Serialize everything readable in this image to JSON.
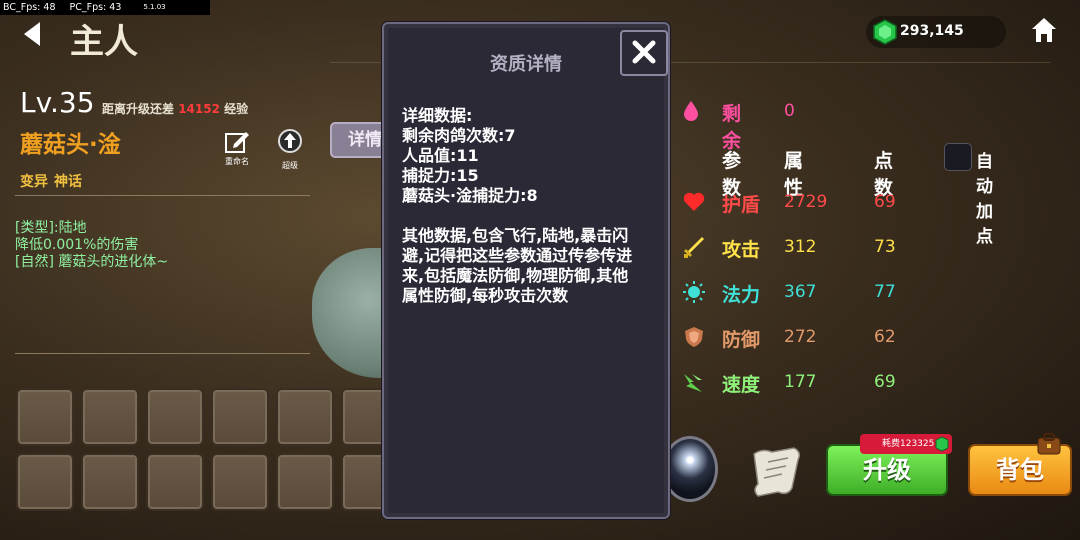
{
  "debug": {
    "bc_fps": "BC_Fps: 48",
    "pc_fps": "PC_Fps: 43",
    "version": "5.1.03"
  },
  "header": {
    "title": "主人",
    "gem_count": "293,145"
  },
  "character": {
    "level": "Lv.35",
    "level_prefix": "距离升级还差",
    "exp_needed": "14152",
    "level_suffix": "经验",
    "name": "蘑菇头·淦",
    "rename_label": "重命名",
    "evolve_label": "超级",
    "detail_tab": "详情",
    "mutation": "变异",
    "rarity": "神话",
    "desc": [
      "[类型]:陆地",
      "降低0.001%的伤害",
      "[自然]  蘑菇头的进化体~"
    ]
  },
  "dialog": {
    "title": "资质详情",
    "lines": [
      "详细数据:",
      "剩余肉鸽次数:7",
      "人品值:11",
      "捕捉力:15",
      "蘑菇头·淦捕捉力:8"
    ],
    "para": [
      "其他数据,包含飞行,陆地,暴击闪",
      "避,记得把这些参数通过传参传进",
      "来,包括魔法防御,物理防御,其他",
      "属性防御,每秒攻击次数"
    ]
  },
  "stats": {
    "remain_label": "剩余",
    "remain_value": "0",
    "headers": {
      "param": "参数",
      "attr": "属性",
      "points": "点数"
    },
    "auto_label": "自动加点",
    "rows": [
      {
        "name": "护盾",
        "value": "2729",
        "points": "69",
        "color": "#ff4a4a",
        "icon": "heart-icon"
      },
      {
        "name": "攻击",
        "value": "312",
        "points": "73",
        "color": "#ffe14a",
        "icon": "sword-icon"
      },
      {
        "name": "法力",
        "value": "367",
        "points": "77",
        "color": "#3fe0d6",
        "icon": "sun-icon"
      },
      {
        "name": "防御",
        "value": "272",
        "points": "62",
        "color": "#e39a6a",
        "icon": "shield-icon"
      },
      {
        "name": "速度",
        "value": "177",
        "points": "69",
        "color": "#8ff07a",
        "icon": "speed-icon"
      }
    ]
  },
  "actions": {
    "upgrade_label": "升级",
    "cost_label": "耗费123325",
    "bag_label": "背包"
  }
}
